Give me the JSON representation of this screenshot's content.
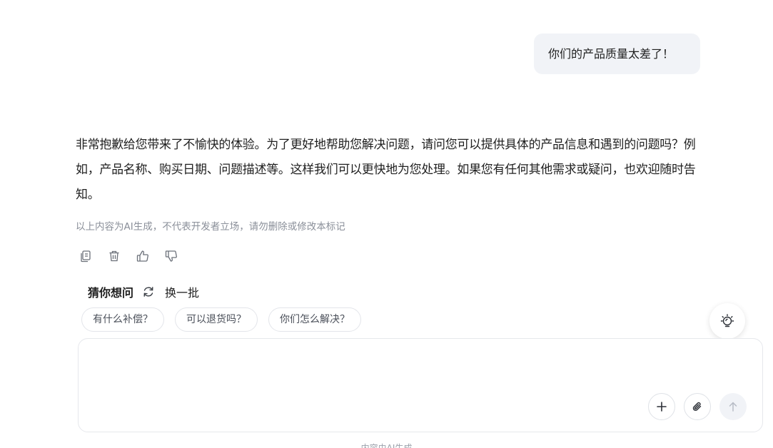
{
  "conversation": {
    "user_message": "你们的产品质量太差了！",
    "assistant_message": "非常抱歉给您带来了不愉快的体验。为了更好地帮助您解决问题，请问您可以提供具体的产品信息和遇到的问题吗？例如，产品名称、购买日期、问题描述等。这样我们可以更快地为您处理。如果您有任何其他需求或疑问，也欢迎随时告知。",
    "ai_disclaimer": "以上内容为AI生成，不代表开发者立场，请勿删除或修改本标记"
  },
  "message_actions": {
    "icons": [
      "copy-icon",
      "trash-icon",
      "thumbs-up-icon",
      "thumbs-down-icon"
    ]
  },
  "suggestions": {
    "title": "猜你想问",
    "refresh_label": "换一批",
    "items": [
      "有什么补偿？",
      "可以退货吗？",
      "你们怎么解决？"
    ]
  },
  "composer": {
    "placeholder": "",
    "buttons": [
      "plus-icon",
      "paperclip-icon",
      "arrow-up-icon"
    ]
  },
  "footer": {
    "note": "内容由AI生成"
  },
  "colors": {
    "user_bubble_bg": "#f1f3f7",
    "muted_text": "#8a8f99",
    "border": "#e3e5ea"
  }
}
